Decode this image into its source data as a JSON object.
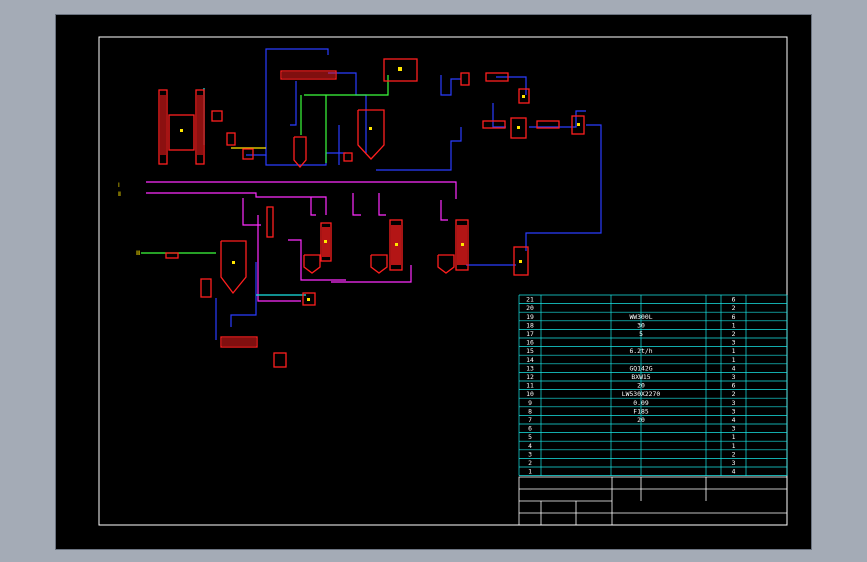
{
  "viewer": {
    "background_color": "#a4abb6",
    "sheet_color": "#000000"
  },
  "colors": {
    "equipment": "#ff1e1e",
    "pipe_blue": "#2a3cff",
    "pipe_magenta": "#ff2cff",
    "pipe_green": "#3cff3c",
    "pipe_cyan": "#19e6e6",
    "pipe_yellow": "#ffe600",
    "border": "#ffffff",
    "table_line": "#19e6e6"
  },
  "diagram": {
    "inlet_labels": [
      "Ⅰ",
      "Ⅱ"
    ],
    "left_inlet_label": "Ⅲ"
  },
  "parts_table": {
    "rows": [
      {
        "no": "21",
        "name": "",
        "spec": "",
        "qty": "6",
        "unit": ""
      },
      {
        "no": "20",
        "name": "",
        "spec": "",
        "qty": "2",
        "unit": ""
      },
      {
        "no": "19",
        "name": "",
        "spec": "WW300L",
        "qty": "6",
        "unit": ""
      },
      {
        "no": "18",
        "name": "",
        "spec": "30",
        "qty": "1",
        "unit": ""
      },
      {
        "no": "17",
        "name": "",
        "spec": "5",
        "qty": "2",
        "unit": ""
      },
      {
        "no": "16",
        "name": "",
        "spec": "",
        "qty": "3",
        "unit": ""
      },
      {
        "no": "15",
        "name": "",
        "spec": "6.2t/h",
        "qty": "1",
        "unit": ""
      },
      {
        "no": "14",
        "name": "",
        "spec": "",
        "qty": "1",
        "unit": ""
      },
      {
        "no": "13",
        "name": "",
        "spec": "GQ142G",
        "qty": "4",
        "unit": ""
      },
      {
        "no": "12",
        "name": "",
        "spec": "BXW15",
        "qty": "3",
        "unit": ""
      },
      {
        "no": "11",
        "name": "",
        "spec": "20",
        "qty": "6",
        "unit": ""
      },
      {
        "no": "10",
        "name": "",
        "spec": "LW530X2270",
        "qty": "2",
        "unit": ""
      },
      {
        "no": "9",
        "name": "",
        "spec": "0.09",
        "qty": "3",
        "unit": ""
      },
      {
        "no": "8",
        "name": "",
        "spec": "F185",
        "qty": "3",
        "unit": ""
      },
      {
        "no": "7",
        "name": "",
        "spec": "20",
        "qty": "4",
        "unit": ""
      },
      {
        "no": "6",
        "name": "",
        "spec": "",
        "qty": "3",
        "unit": ""
      },
      {
        "no": "5",
        "name": "",
        "spec": "",
        "qty": "1",
        "unit": ""
      },
      {
        "no": "4",
        "name": "",
        "spec": "",
        "qty": "1",
        "unit": ""
      },
      {
        "no": "3",
        "name": "",
        "spec": "",
        "qty": "2",
        "unit": ""
      },
      {
        "no": "2",
        "name": "",
        "spec": "",
        "qty": "3",
        "unit": ""
      },
      {
        "no": "1",
        "name": "",
        "spec": "",
        "qty": "4",
        "unit": ""
      }
    ]
  },
  "title_block": {
    "drawing_title": "",
    "sheet_info": "",
    "fields": [
      "",
      "",
      "",
      "",
      ""
    ]
  }
}
